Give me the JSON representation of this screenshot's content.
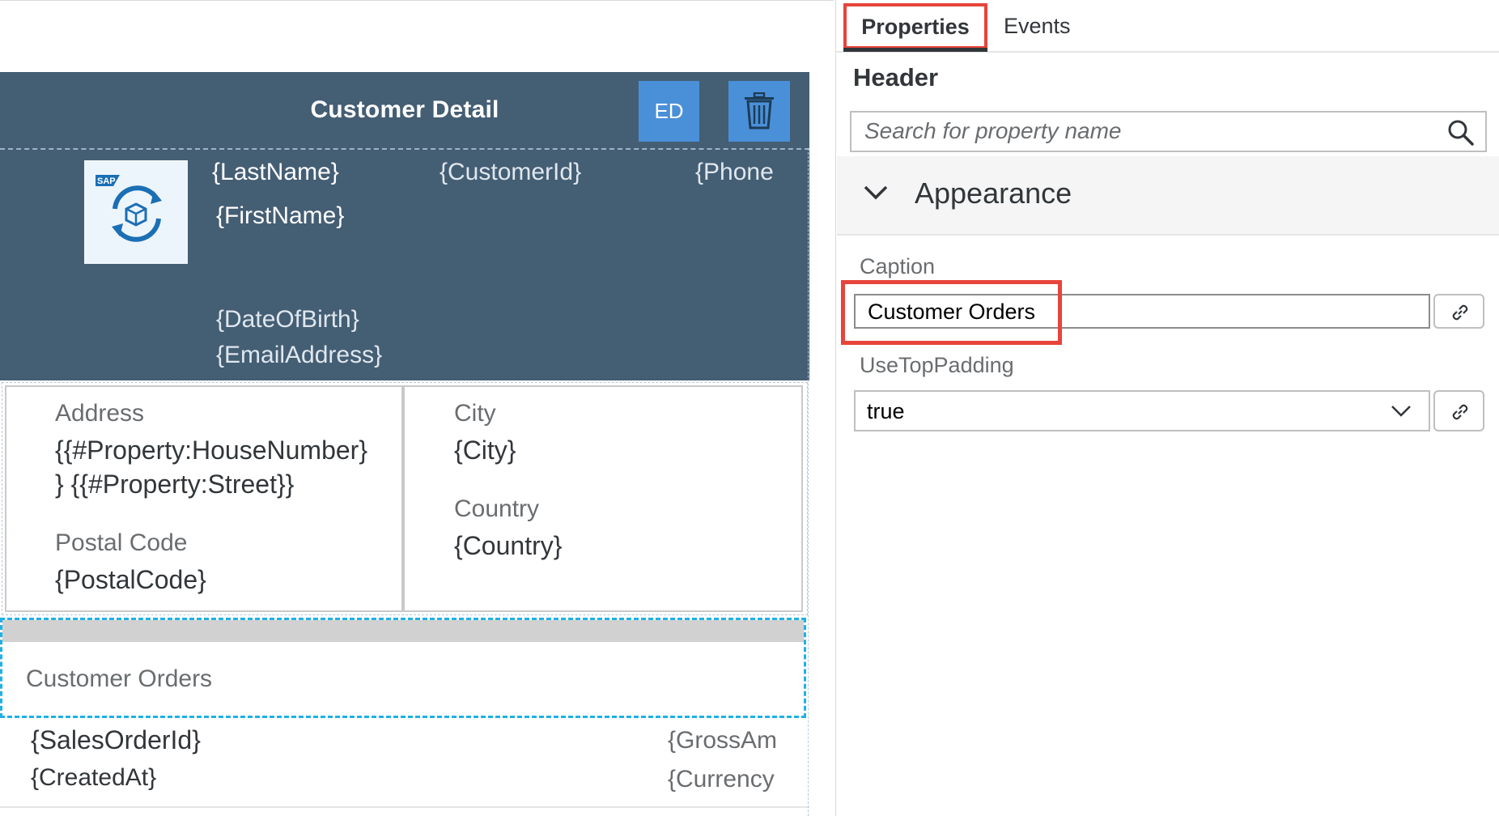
{
  "left": {
    "header": {
      "title": "Customer Detail",
      "ed_button": "ED",
      "delete_icon": "trash-icon"
    },
    "profile": {
      "logo_icon": "sap-sync-icon",
      "logo_text": "SAP",
      "last_name": "{LastName}",
      "first_name": "{FirstName}",
      "customer_id": "{CustomerId}",
      "phone": "{Phone",
      "date_of_birth": "{DateOfBirth}",
      "email": "{EmailAddress}"
    },
    "address_card": {
      "address_label": "Address",
      "address_line1": "{{#Property:HouseNumber}",
      "address_line2": "} {{#Property:Street}}",
      "postal_label": "Postal Code",
      "postal_value": "{PostalCode}"
    },
    "city_card": {
      "city_label": "City",
      "city_value": "{City}",
      "country_label": "Country",
      "country_value": "{Country}"
    },
    "orders": {
      "caption": "Customer Orders",
      "row": {
        "sales_order_id": "{SalesOrderId}",
        "created_at": "{CreatedAt}",
        "gross_amount": "{GrossAm",
        "currency": "{Currency"
      }
    }
  },
  "right": {
    "tabs": {
      "properties": "Properties",
      "events": "Events"
    },
    "header_title": "Header",
    "search_placeholder": "Search for property name",
    "section_title": "Appearance",
    "caption_label": "Caption",
    "caption_value": "Customer Orders",
    "use_top_padding_label": "UseTopPadding",
    "use_top_padding_value": "true"
  },
  "colors": {
    "header_bg": "#445e74",
    "button_bg": "#4a90d9",
    "highlight": "#e8443a",
    "selection_dash": "#1fb1e6"
  }
}
